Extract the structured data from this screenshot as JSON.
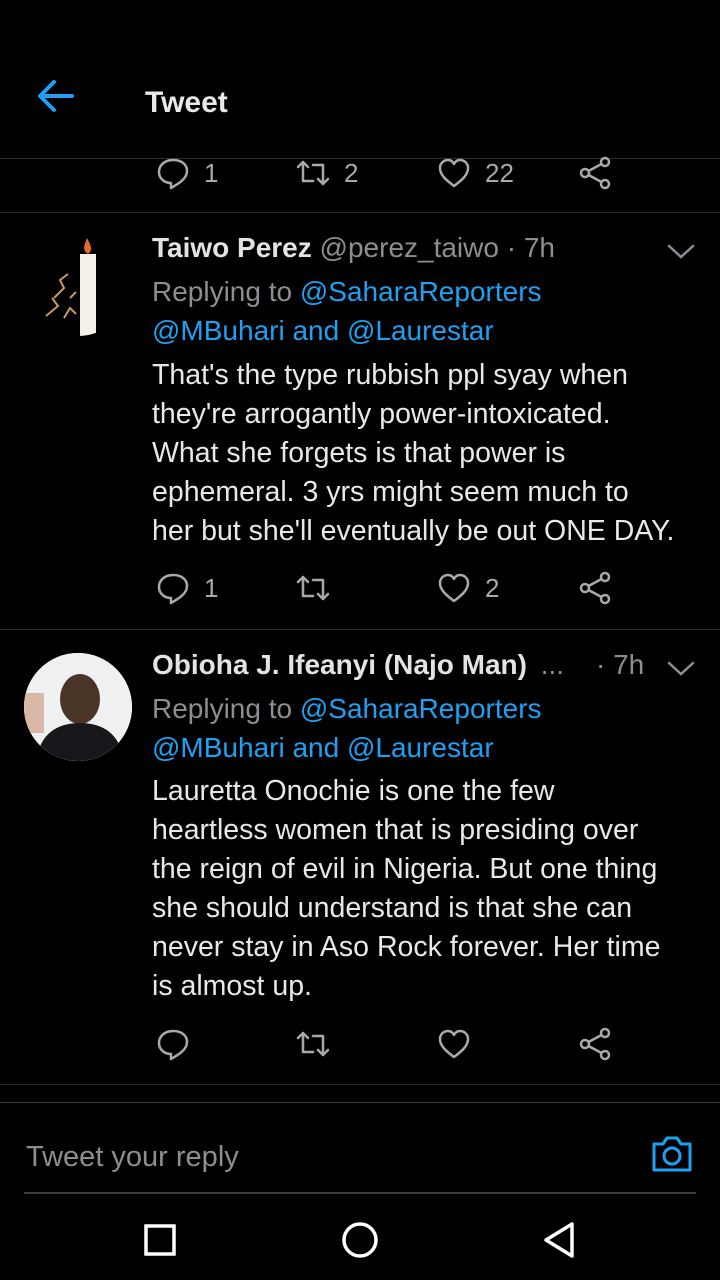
{
  "header": {
    "title": "Tweet",
    "back_icon": "arrow-left-icon",
    "accent": "#1da1f2"
  },
  "top_actions": {
    "reply_count": "1",
    "retweet_count": "2",
    "like_count": "22"
  },
  "tweets": [
    {
      "name": "Taiwo Perez",
      "handle": "@perez_taiwo",
      "time": "· 7h",
      "replying_prefix": "Replying to",
      "mention1": "@SaharaReporters",
      "mention2": "@MBuhari",
      "and_word": "and",
      "mention3": "@Laurestar",
      "lines": [
        "That's the type rubbish ppl syay when",
        "they're arrogantly power-intoxicated.",
        "What she forgets is that power is",
        "ephemeral. 3 yrs might seem much to",
        "her but she'll eventually be out ONE DAY."
      ],
      "reply_count": "1",
      "retweet_count": "",
      "like_count": "2"
    },
    {
      "name": "Obioha J. Ifeanyi (Najo Man)",
      "ellipsis": "...",
      "time": "· 7h",
      "replying_prefix": "Replying to",
      "mention1": "@SaharaReporters",
      "mention2": "@MBuhari",
      "and_word": "and",
      "mention3": "@Laurestar",
      "lines": [
        "Lauretta Onochie is one the few",
        "heartless women that is presiding over",
        "the reign of evil in Nigeria. But one thing",
        "she should understand is that she can",
        "never stay in Aso Rock forever. Her time",
        "is almost up."
      ],
      "reply_count": "",
      "retweet_count": "",
      "like_count": ""
    }
  ],
  "compose": {
    "placeholder": "Tweet your reply",
    "camera_icon": "camera-icon"
  },
  "navbar": {
    "icons": [
      "recent-apps-icon",
      "home-icon",
      "back-triangle-icon"
    ]
  }
}
